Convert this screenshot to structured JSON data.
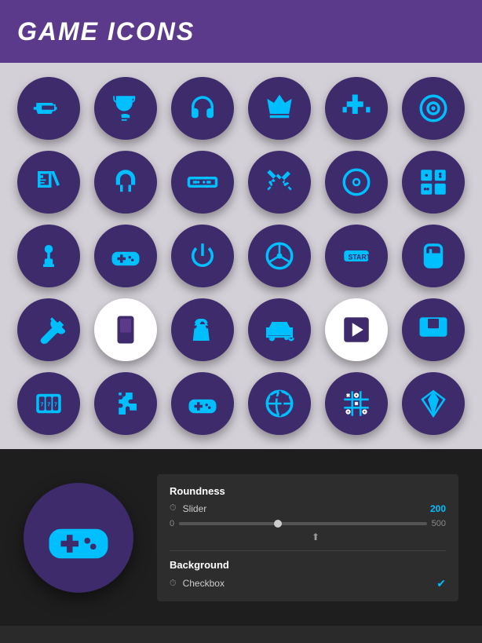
{
  "header": {
    "title": "GAME ICONS"
  },
  "icons": [
    {
      "name": "gun",
      "row": 0
    },
    {
      "name": "trophy",
      "row": 0
    },
    {
      "name": "headphones",
      "row": 0
    },
    {
      "name": "crown",
      "row": 0
    },
    {
      "name": "dpad",
      "row": 0
    },
    {
      "name": "target",
      "row": 0
    },
    {
      "name": "cards",
      "row": 1
    },
    {
      "name": "horseshoe",
      "row": 1
    },
    {
      "name": "vr-headset",
      "row": 1
    },
    {
      "name": "crossed-swords",
      "row": 1
    },
    {
      "name": "disc",
      "row": 1
    },
    {
      "name": "dice",
      "row": 1
    },
    {
      "name": "joystick",
      "row": 2
    },
    {
      "name": "gamepad",
      "row": 2
    },
    {
      "name": "power",
      "row": 2
    },
    {
      "name": "steering-wheel",
      "row": 2
    },
    {
      "name": "start-ticket",
      "row": 2
    },
    {
      "name": "mouse",
      "row": 2
    },
    {
      "name": "guitar",
      "row": 3
    },
    {
      "name": "mp3-player",
      "row": 3
    },
    {
      "name": "chess-knight",
      "row": 3
    },
    {
      "name": "car",
      "row": 3
    },
    {
      "name": "play-button",
      "row": 3
    },
    {
      "name": "monitor",
      "row": 3
    },
    {
      "name": "slot-machine",
      "row": 4
    },
    {
      "name": "puzzle",
      "row": 4
    },
    {
      "name": "gamepad2",
      "row": 4
    },
    {
      "name": "beach-ball",
      "row": 4
    },
    {
      "name": "tic-tac-toe",
      "row": 4
    },
    {
      "name": "diamond",
      "row": 4
    }
  ],
  "preview": {
    "icon": "gamepad"
  },
  "controls": {
    "roundness_label": "Roundness",
    "slider_label": "Slider",
    "slider_value": "200",
    "slider_min": "0",
    "slider_max": "500",
    "background_label": "Background",
    "checkbox_label": "Checkbox",
    "checkbox_checked": true
  }
}
